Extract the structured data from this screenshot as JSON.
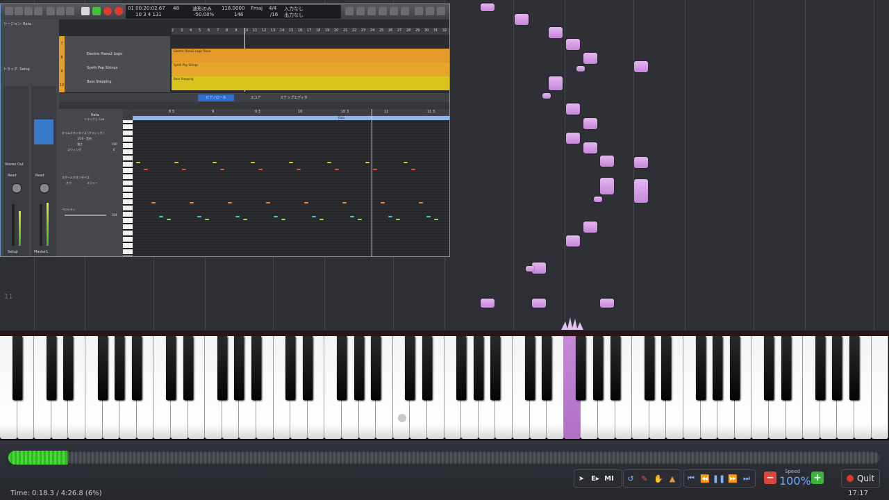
{
  "roll": {
    "measure_label": "11",
    "note_color": "#d6a0e6"
  },
  "keyboard": {
    "active_key_color": "#c07ad4",
    "pressed_key": "active"
  },
  "progress": {
    "fraction": 0.068,
    "color": "#3ccb30"
  },
  "status": {
    "time_label": "Time:",
    "time_value": "0:18.3 / 4:26.8 (6%)",
    "clock": "17:17"
  },
  "toolbar": {
    "tools": [
      "pointer-icon",
      "E▸",
      "MI",
      "undo-icon",
      "pencil-icon",
      "hand-icon",
      "stamp-icon"
    ],
    "e_label": "E▸",
    "mi_label": "MI",
    "transport": [
      "skip-back-icon",
      "rewind-icon",
      "pause-icon",
      "forward-icon",
      "skip-forward-icon"
    ]
  },
  "speed": {
    "label": "Speed",
    "value": "100%",
    "minus": "−",
    "plus": "+"
  },
  "quit": {
    "label": "Quit"
  },
  "daw": {
    "lcd": {
      "position": "01 00:20:02.67",
      "bars": "10  3  4  131",
      "left_label": "48",
      "mode": "波形のみ",
      "percent": "-50.00%",
      "tempo": "116.0000",
      "tempo_sub": "146",
      "key": "Fmaj",
      "sig": "4/4",
      "division": "/16",
      "in_label": "入力なし",
      "out_label": "出力なし"
    },
    "inspector": {
      "region_label": "リージョン: Rata",
      "track_label": "トラック: Setup",
      "strip_left": "Setup",
      "strip_right": "Master1",
      "ch_left": "Stereo Out",
      "read_left": "Read",
      "read_right": "Read"
    },
    "ruler_marks": [
      "2",
      "3",
      "4",
      "5",
      "6",
      "7",
      "8",
      "9",
      "10",
      "11",
      "12",
      "13",
      "14",
      "15",
      "16",
      "17",
      "18",
      "19",
      "20",
      "21",
      "22",
      "23",
      "24",
      "25",
      "26",
      "27",
      "28",
      "29",
      "30",
      "31",
      "32"
    ],
    "tracks": [
      {
        "num": "7",
        "name": "",
        "region": "",
        "color": "#e39a2a"
      },
      {
        "num": "8",
        "name": "Electric Piano2 Logic",
        "region": "Electric Piano2 Logic Piano",
        "color": "#e39a2a"
      },
      {
        "num": "9",
        "name": "Synth Pop Strings",
        "region": "Synth Pop Strings",
        "color": "#e8a52c"
      },
      {
        "num": "10",
        "name": "Bass Stepping",
        "region": "Bass Stepping",
        "color": "#d9c51e"
      }
    ],
    "editor_tabs": [
      "ピアノロール",
      "スコア",
      "ステップエディタ"
    ],
    "editor_left": {
      "title": "Rata",
      "subtitle": "トラック上 Cue",
      "quantize": "タイムクオンタイズ (クラシック)",
      "quantize_value": "1/16 - 音符",
      "strength": "強さ",
      "strength_value": "100",
      "swing": "スウィング",
      "swing_value": "0",
      "scale": "スケールクオンタイズ",
      "scale_off": "オフ",
      "scale_major": "メジャー",
      "velocity": "ベロシティ",
      "velocity_value": "104"
    },
    "pr_ruler": [
      "8 3",
      "9",
      "9 3",
      "10",
      "10 3",
      "11",
      "11 3"
    ],
    "pr_ruler_region": "Rata"
  }
}
